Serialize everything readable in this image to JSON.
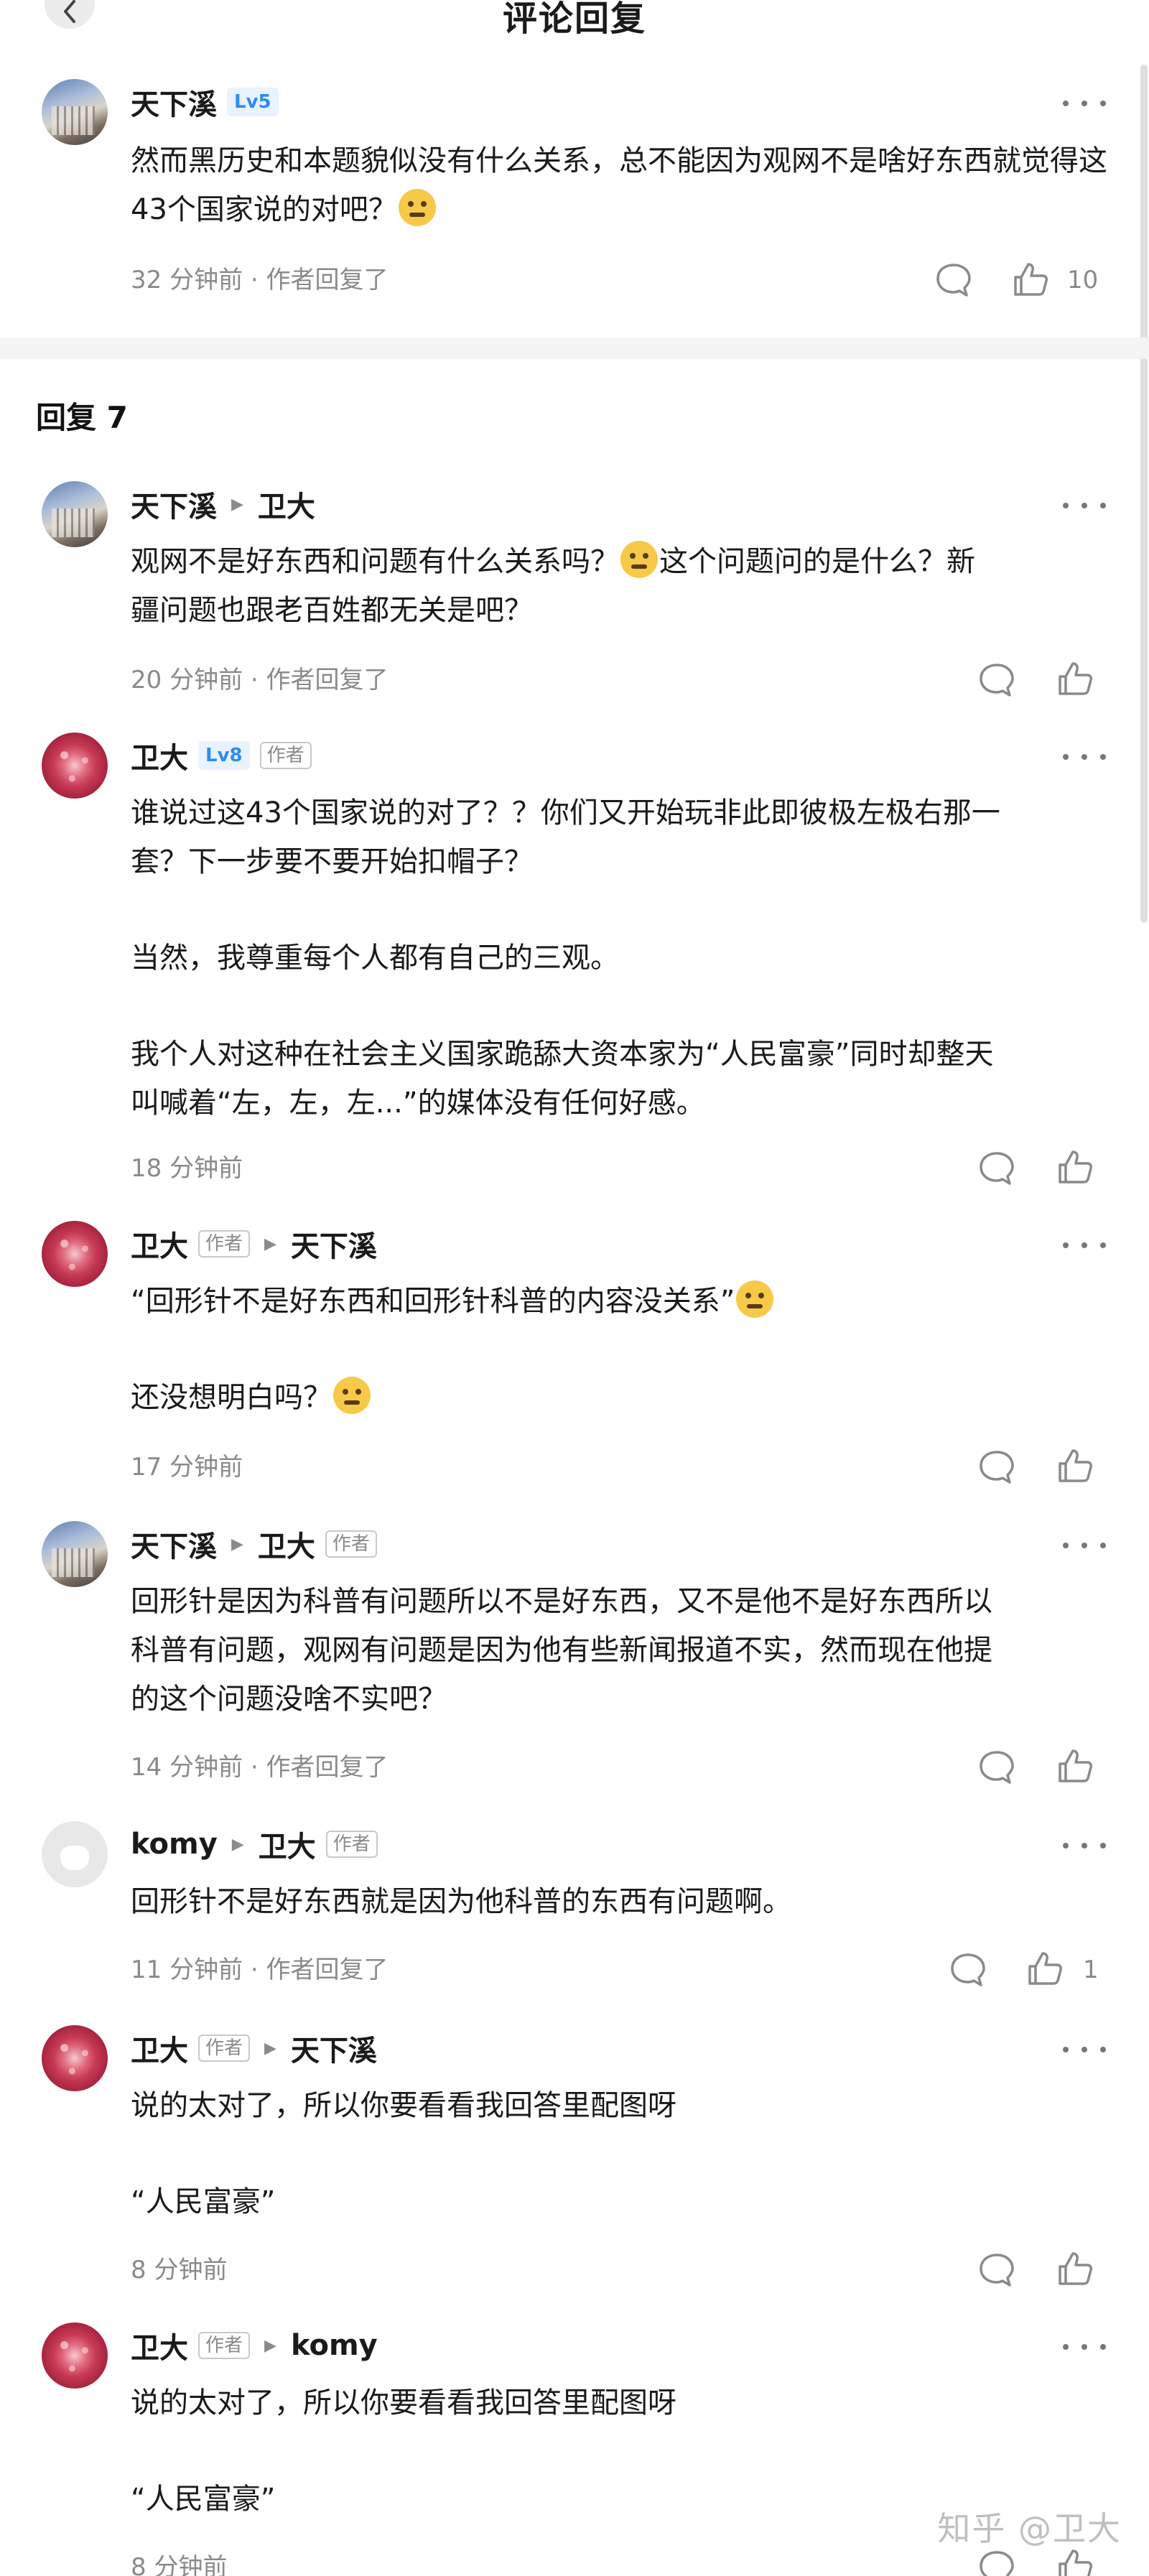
{
  "header": {
    "title": "评论回复"
  },
  "root_comment": {
    "user": "天下溪",
    "level": "Lv5",
    "text": "然而黑历史和本题貌似没有什么关系，总不能因为观网不是啥好东西就觉得这43个国家说的对吧？",
    "time": "32 分钟前 · 作者回复了",
    "likes": "10"
  },
  "replies_header": "回复 7",
  "replies": [
    {
      "user": "天下溪",
      "target": "卫大",
      "lines": [
        "观网不是好东西和问题有什么关系吗？",
        "这个问题问的是什么？新",
        "疆问题也跟老百姓都无关是吧？"
      ],
      "time": "20 分钟前 · 作者回复了"
    },
    {
      "user": "卫大",
      "level": "Lv8",
      "tag": "作者",
      "lines": [
        "谁说过这43个国家说的对了？？你们又开始玩非此即彼极左极右那一",
        "套？下一步要不要开始扣帽子？",
        "当然，我尊重每个人都有自己的三观。",
        "我个人对这种在社会主义国家跪舔大资本家为“人民富豪”同时却整天",
        "叫喊着“左，左，左...”的媒体没有任何好感。"
      ],
      "time": "18 分钟前"
    },
    {
      "user": "卫大",
      "tag": "作者",
      "target": "天下溪",
      "lines": [
        "“回形针不是好东西和回形针科普的内容没关系”",
        "还没想明白吗？"
      ],
      "time": "17 分钟前"
    },
    {
      "user": "天下溪",
      "target": "卫大",
      "target_tag": "作者",
      "lines": [
        "回形针是因为科普有问题所以不是好东西，又不是他不是好东西所以",
        "科普有问题，观网有问题是因为他有些新闻报道不实，然而现在他提",
        "的这个问题没啥不实吧？"
      ],
      "time": "14 分钟前 · 作者回复了"
    },
    {
      "user": "komy",
      "target": "卫大",
      "target_tag": "作者",
      "lines": [
        "回形针不是好东西就是因为他科普的东西有问题啊。"
      ],
      "time": "11 分钟前 · 作者回复了",
      "likes": "1"
    },
    {
      "user": "卫大",
      "tag": "作者",
      "target": "天下溪",
      "lines": [
        "说的太对了，所以你要看看我回答里配图呀",
        "“人民富豪”"
      ],
      "time": "8 分钟前"
    },
    {
      "user": "卫大",
      "tag": "作者",
      "target": "komy",
      "lines": [
        "说的太对了，所以你要看看我回答里配图呀",
        "“人民富豪”"
      ],
      "time": "8 分钟前"
    }
  ],
  "watermark": "知乎 @卫大",
  "icons": {
    "back": "chevron-left-icon",
    "more": "more-dots-icon",
    "reply": "comment-bubble-icon",
    "like": "thumbs-up-icon"
  }
}
